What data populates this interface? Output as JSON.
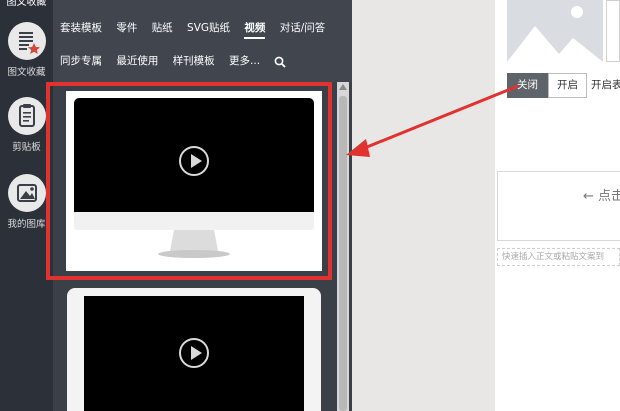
{
  "sidebar": {
    "top_label": "图文收藏",
    "items": [
      {
        "label": "图文收藏",
        "icon": "document-star-icon"
      },
      {
        "label": "剪贴板",
        "icon": "clipboard-icon"
      },
      {
        "label": "我的图库",
        "icon": "image-gallery-icon"
      }
    ]
  },
  "nav": {
    "row1": [
      "套装模板",
      "零件",
      "贴纸",
      "SVG贴纸",
      "视频",
      "对话/问答"
    ],
    "row2": [
      "同步专属",
      "最近使用",
      "样刊模板",
      "更多..."
    ],
    "active": "视频"
  },
  "editor": {
    "toggle_off": "关闭",
    "toggle_on": "开启",
    "toggle_label": "开启",
    "toggle_label_tail": "表",
    "click_text": "← 点击",
    "hint_text": "快速插入正文或粘贴文案到"
  },
  "colors": {
    "highlight": "#e2322f",
    "sidebar_bg": "#2c3038",
    "panel_bg": "#3a3f48"
  }
}
